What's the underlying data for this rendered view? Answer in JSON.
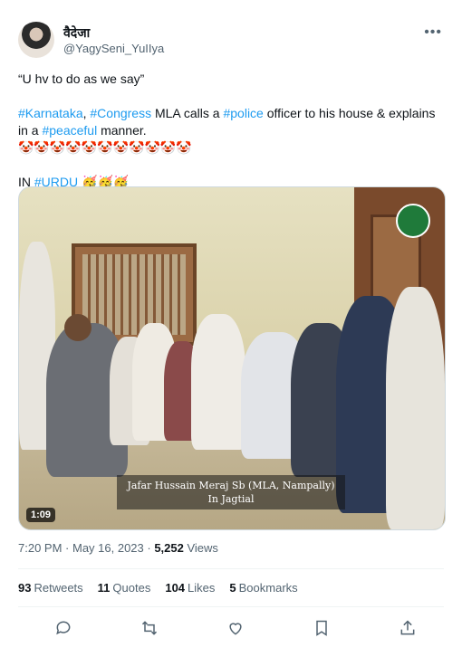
{
  "user": {
    "display_name": "वैदेजा",
    "handle": "@YagySeni_YuIIya"
  },
  "tweet": {
    "line1": "“U hv to do as we say”",
    "line2_tags": [
      "#Karnataka",
      "#Congress",
      "#police",
      "#peaceful"
    ],
    "line2_pre": ", ",
    "line2_mid1": " MLA calls a ",
    "line2_mid2": " officer to his house & explains in a ",
    "line2_post": " manner.",
    "clowns": "🤡🤡🤡🤡🤡🤡🤡🤡🤡🤡🤡",
    "line4_pre": "IN ",
    "line4_tag": "#URDU",
    "line4_emoji": "🥳🥳🥳"
  },
  "media": {
    "caption": "Jafar Hussain Meraj Sb (MLA, Nampally) In Jagtial",
    "duration": "1:09"
  },
  "meta": {
    "time": "7:20 PM",
    "sep1": " · ",
    "date": "May 16, 2023",
    "sep2": " · ",
    "views_count": "5,252",
    "views_label": " Views"
  },
  "stats": {
    "retweets_count": "93",
    "retweets_label": "Retweets",
    "quotes_count": "11",
    "quotes_label": "Quotes",
    "likes_count": "104",
    "likes_label": "Likes",
    "bookmarks_count": "5",
    "bookmarks_label": "Bookmarks"
  },
  "icons": [
    "more-icon",
    "reply-icon",
    "retweet-icon",
    "like-icon",
    "bookmark-icon",
    "share-icon"
  ],
  "colors": {
    "link": "#1d9bf0",
    "text": "#0f1419",
    "muted": "#536471"
  }
}
